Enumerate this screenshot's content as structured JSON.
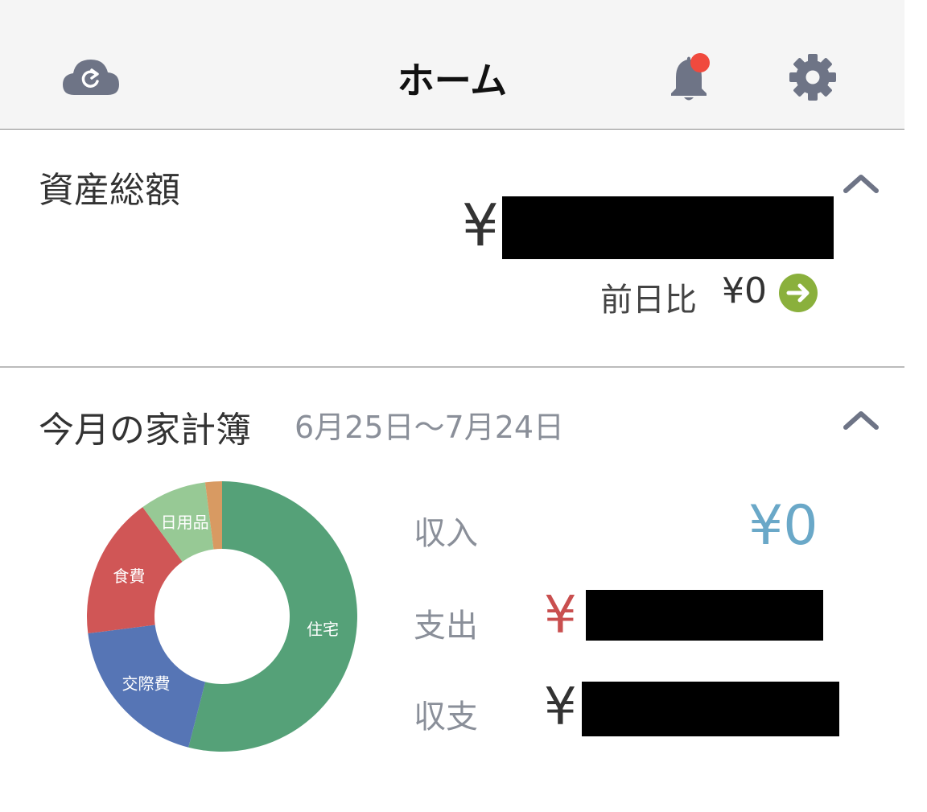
{
  "header": {
    "title": "ホーム",
    "icons": {
      "sync": "cloud-refresh-icon",
      "notifications": "bell-icon",
      "settings": "gear-icon"
    },
    "notification_dot_color": "#f04a3e"
  },
  "assets": {
    "title": "資産総額",
    "currency": "¥",
    "compare_label": "前日比",
    "compare_value": "¥0",
    "compare_icon": "arrow-right-circle-icon",
    "compare_icon_color": "#8ab03c"
  },
  "budget": {
    "title": "今月の家計簿",
    "period": "6月25日〜7月24日",
    "income": {
      "label": "収入",
      "value": "¥0",
      "color": "#6aa8c8"
    },
    "expense": {
      "label": "支出",
      "value": "¥",
      "color": "#c94f4f"
    },
    "balance": {
      "label": "収支",
      "value": "¥",
      "color": "#333333"
    }
  },
  "chart_data": {
    "type": "pie",
    "donut": true,
    "slices": [
      {
        "label": "住宅",
        "value": 54,
        "color": "#55a178"
      },
      {
        "label": "交際費",
        "value": 19,
        "color": "#5675b5"
      },
      {
        "label": "食費",
        "value": 17,
        "color": "#d05656"
      },
      {
        "label": "日用品",
        "value": 8,
        "color": "#97c995"
      },
      {
        "label": "",
        "value": 2,
        "color": "#d89a62"
      }
    ]
  }
}
